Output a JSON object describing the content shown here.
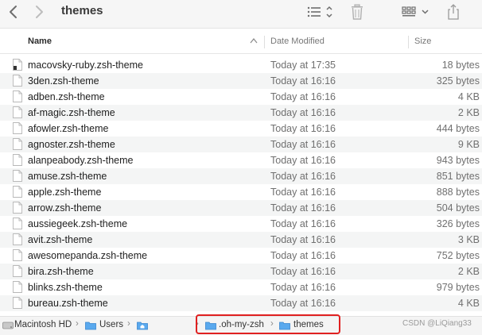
{
  "window": {
    "title": "themes"
  },
  "toolbar": {
    "back_icon": "chevron-left-icon",
    "forward_icon": "chevron-right-icon",
    "list_view_icon": "list-view-icon",
    "trash_icon": "trash-icon",
    "grid_view_icon": "grid-view-icon",
    "share_icon": "share-icon"
  },
  "columns": {
    "name": "Name",
    "date": "Date Modified",
    "size": "Size",
    "sort": "name-descending"
  },
  "files": [
    {
      "name": "macovsky-ruby.zsh-theme",
      "date": "Today at 17:35",
      "size": "18 bytes",
      "icon": "executable-file-icon"
    },
    {
      "name": "3den.zsh-theme",
      "date": "Today at 16:16",
      "size": "325 bytes",
      "icon": "document-icon"
    },
    {
      "name": "adben.zsh-theme",
      "date": "Today at 16:16",
      "size": "4 KB",
      "icon": "document-icon"
    },
    {
      "name": "af-magic.zsh-theme",
      "date": "Today at 16:16",
      "size": "2 KB",
      "icon": "document-icon"
    },
    {
      "name": "afowler.zsh-theme",
      "date": "Today at 16:16",
      "size": "444 bytes",
      "icon": "document-icon"
    },
    {
      "name": "agnoster.zsh-theme",
      "date": "Today at 16:16",
      "size": "9 KB",
      "icon": "document-icon"
    },
    {
      "name": "alanpeabody.zsh-theme",
      "date": "Today at 16:16",
      "size": "943 bytes",
      "icon": "document-icon"
    },
    {
      "name": "amuse.zsh-theme",
      "date": "Today at 16:16",
      "size": "851 bytes",
      "icon": "document-icon"
    },
    {
      "name": "apple.zsh-theme",
      "date": "Today at 16:16",
      "size": "888 bytes",
      "icon": "document-icon"
    },
    {
      "name": "arrow.zsh-theme",
      "date": "Today at 16:16",
      "size": "504 bytes",
      "icon": "document-icon"
    },
    {
      "name": "aussiegeek.zsh-theme",
      "date": "Today at 16:16",
      "size": "326 bytes",
      "icon": "document-icon"
    },
    {
      "name": "avit.zsh-theme",
      "date": "Today at 16:16",
      "size": "3 KB",
      "icon": "document-icon"
    },
    {
      "name": "awesomepanda.zsh-theme",
      "date": "Today at 16:16",
      "size": "752 bytes",
      "icon": "document-icon"
    },
    {
      "name": "bira.zsh-theme",
      "date": "Today at 16:16",
      "size": "2 KB",
      "icon": "document-icon"
    },
    {
      "name": "blinks.zsh-theme",
      "date": "Today at 16:16",
      "size": "979 bytes",
      "icon": "document-icon"
    },
    {
      "name": "bureau.zsh-theme",
      "date": "Today at 16:16",
      "size": "4 KB",
      "icon": "document-icon"
    }
  ],
  "pathbar": {
    "disk": "Macintosh HD",
    "users": "Users",
    "ohmyzsh": ".oh-my-zsh",
    "themes": "themes",
    "highlight_color": "#e02020",
    "folder_color": "#4a9eea"
  },
  "watermark": "CSDN @LiQiang33"
}
